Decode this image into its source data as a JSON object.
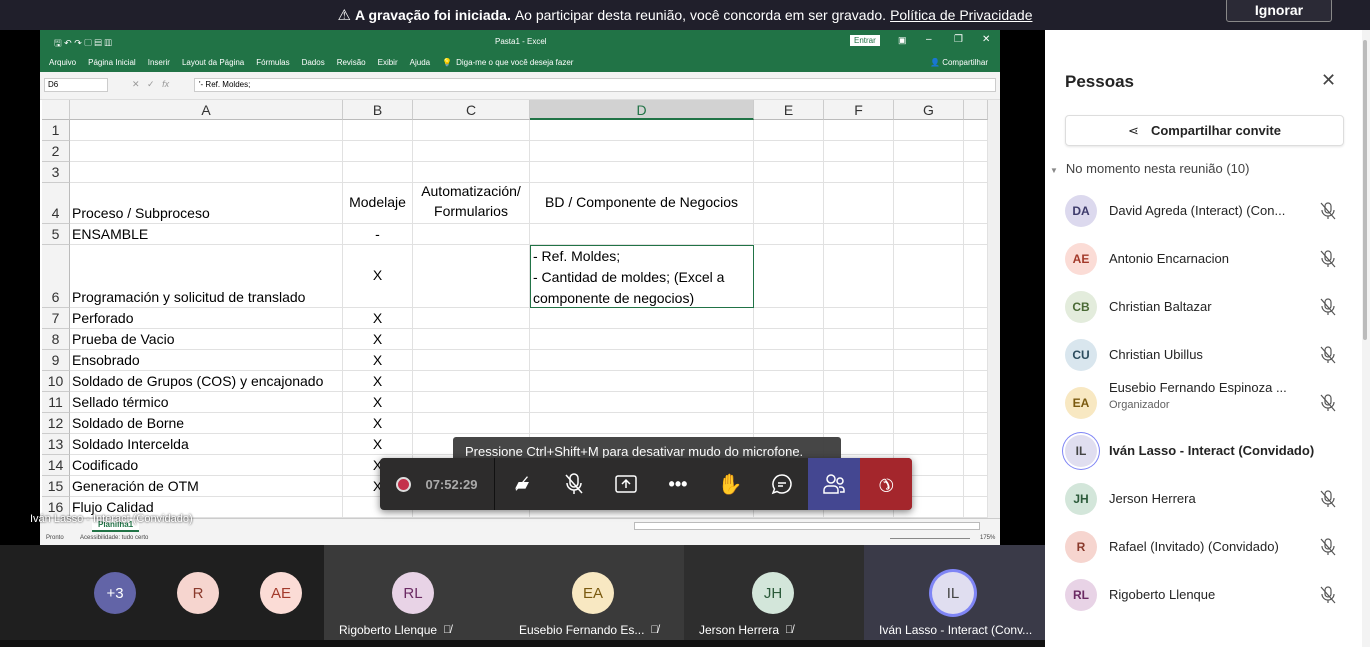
{
  "banner": {
    "bold": "A gravação foi iniciada.",
    "text": "Ao participar desta reunião, você concorda em ser gravado.",
    "link": "Política de Privacidade",
    "ignore": "Ignorar"
  },
  "excel": {
    "title": "Pasta1 - Excel",
    "signin": "Entrar",
    "share": "Compartilhar",
    "ribbon": [
      "Arquivo",
      "Página Inicial",
      "Inserir",
      "Layout da Página",
      "Fórmulas",
      "Dados",
      "Revisão",
      "Exibir",
      "Ajuda"
    ],
    "tellme": "Diga-me o que você deseja fazer",
    "namebox": "D6",
    "formula": "'- Ref. Moldes;",
    "columns": [
      "A",
      "B",
      "C",
      "D",
      "E",
      "F",
      "G"
    ],
    "rows": [
      {
        "n": "1",
        "a": "",
        "b": "",
        "c": "",
        "d": ""
      },
      {
        "n": "2",
        "a": "",
        "b": "",
        "c": "",
        "d": ""
      },
      {
        "n": "3",
        "a": "",
        "b": "",
        "c": "",
        "d": ""
      },
      {
        "n": "4",
        "a": "Proceso / Subproceso",
        "b": "Modelaje",
        "c": "Automatización/ Formularios",
        "d": "BD / Componente de Negocios"
      },
      {
        "n": "5",
        "a": "ENSAMBLE",
        "b": "-",
        "c": "",
        "d": ""
      },
      {
        "n": "6",
        "a": "Programación y solicitud de translado",
        "b": "X",
        "c": "",
        "d": "- Ref. Moldes;\n- Cantidad de moldes; (Excel a componente de negocios)"
      },
      {
        "n": "7",
        "a": "Perforado",
        "b": "X",
        "c": "",
        "d": ""
      },
      {
        "n": "8",
        "a": "Prueba de Vacio",
        "b": "X",
        "c": "",
        "d": ""
      },
      {
        "n": "9",
        "a": "Ensobrado",
        "b": "X",
        "c": "",
        "d": ""
      },
      {
        "n": "10",
        "a": "Soldado de Grupos (COS) y encajonado",
        "b": "X",
        "c": "",
        "d": ""
      },
      {
        "n": "11",
        "a": "Sellado térmico",
        "b": "X",
        "c": "",
        "d": ""
      },
      {
        "n": "12",
        "a": "Soldado de Borne",
        "b": "X",
        "c": "",
        "d": ""
      },
      {
        "n": "13",
        "a": "Soldado Intercelda",
        "b": "X",
        "c": "",
        "d": ""
      },
      {
        "n": "14",
        "a": "Codificado",
        "b": "X",
        "c": "",
        "d": ""
      },
      {
        "n": "15",
        "a": "Generación de OTM",
        "b": "X",
        "c": "",
        "d": ""
      },
      {
        "n": "16",
        "a": "Flujo Calidad",
        "b": "",
        "c": "",
        "d": ""
      }
    ],
    "sheet_tab": "Planilha1",
    "status": "Pronto",
    "accessibility": "Acessibilidade: tudo certo",
    "zoom": "175%"
  },
  "presenter_label": "Iván Lasso - Interact (Convidado)",
  "tooltip": "Pressione Ctrl+Shift+M para desativar mudo do microfone.",
  "callbar": {
    "timer": "07:52:29",
    "record_color": "#c4314b",
    "leave_color": "#a4262c"
  },
  "tiles": [
    {
      "initials": "+3",
      "bg": "#6264a7",
      "fg": "#fff"
    },
    {
      "initials": "R",
      "bg": "#f6d5cf",
      "fg": "#8a3a2c"
    },
    {
      "initials": "AE",
      "bg": "#fbdcd6",
      "fg": "#a33a2b"
    },
    {
      "initials": "RL",
      "bg": "#e8d3e6",
      "fg": "#6b2a63",
      "name": "Rigoberto Llenque"
    },
    {
      "initials": "EA",
      "bg": "#f8e8c2",
      "fg": "#7a5a10",
      "name": "Eusebio Fernando Es..."
    },
    {
      "initials": "JH",
      "bg": "#d3e6da",
      "fg": "#2b5a3a",
      "name": "Jerson Herrera"
    },
    {
      "initials": "IL",
      "bg": "#e0def0",
      "fg": "#444",
      "name": "Iván Lasso - Interact (Conv..."
    }
  ],
  "panel": {
    "title": "Pessoas",
    "share_invite": "Compartilhar convite",
    "section": "No momento nesta reunião (10)",
    "people": [
      {
        "initials": "DA",
        "name": "David Agreda (Interact) (Con...",
        "bg": "#dcd9ee",
        "fg": "#3d3a6b"
      },
      {
        "initials": "AE",
        "name": "Antonio Encarnacion",
        "bg": "#fbdcd6",
        "fg": "#a33a2b"
      },
      {
        "initials": "CB",
        "name": "Christian Baltazar",
        "bg": "#e3ecdc",
        "fg": "#4a6a35"
      },
      {
        "initials": "CU",
        "name": "Christian Ubillus",
        "bg": "#d9e6ee",
        "fg": "#2d4d5e"
      },
      {
        "initials": "EA",
        "name": "Eusebio Fernando Espinoza ...",
        "sub": "Organizador",
        "bg": "#f8e8c2",
        "fg": "#7a5a10"
      },
      {
        "initials": "IL",
        "name": "Iván Lasso - Interact (Convidado)",
        "bg": "#e0def0",
        "fg": "#444",
        "speaking": true
      },
      {
        "initials": "JH",
        "name": "Jerson Herrera",
        "bg": "#d3e6da",
        "fg": "#2b5a3a"
      },
      {
        "initials": "R",
        "name": "Rafael (Invitado) (Convidado)",
        "bg": "#f6d5cf",
        "fg": "#8a3a2c"
      },
      {
        "initials": "RL",
        "name": "Rigoberto Llenque",
        "bg": "#e8d3e6",
        "fg": "#6b2a63"
      }
    ]
  }
}
